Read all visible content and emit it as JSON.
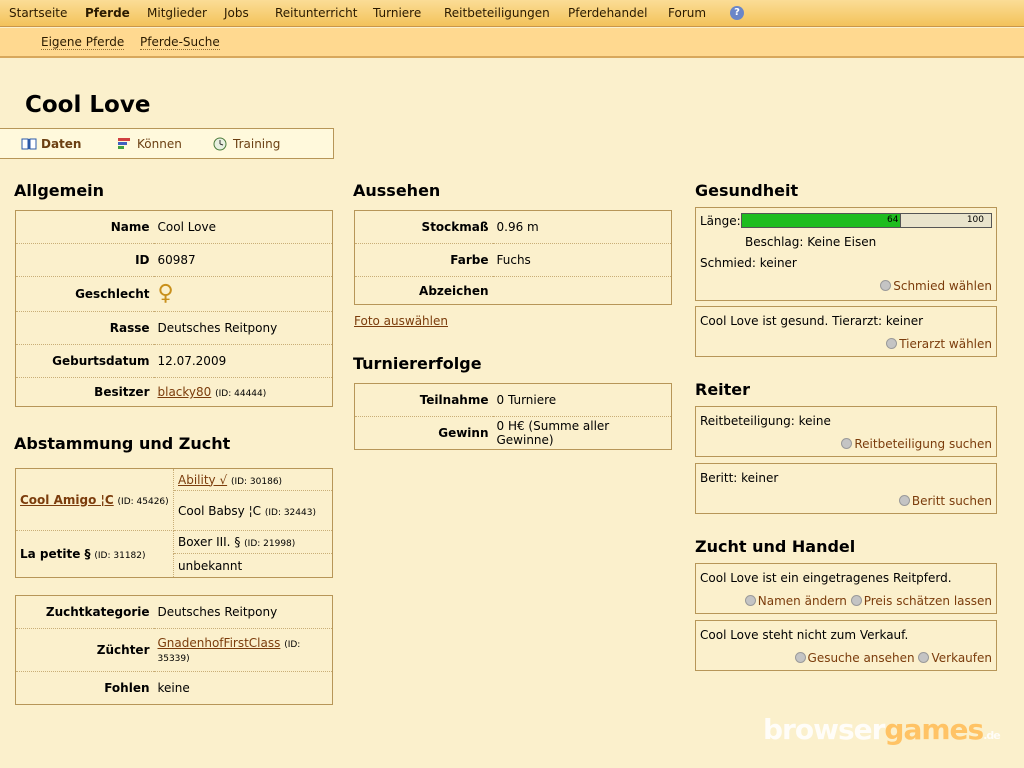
{
  "nav": {
    "items": [
      "Startseite",
      "Pferde",
      "Mitglieder",
      "Jobs",
      "Reitunterricht",
      "Turniere",
      "Reitbeteiligungen",
      "Pferdehandel",
      "Forum"
    ],
    "help": "?"
  },
  "subnav": [
    "Eigene Pferde",
    "Pferde-Suche"
  ],
  "title": "Cool Love",
  "tabs": [
    "Daten",
    "Können",
    "Training"
  ],
  "allgemein": {
    "heading": "Allgemein",
    "name_label": "Name",
    "name": "Cool Love",
    "id_label": "ID",
    "id": "60987",
    "sex_label": "Geschlecht",
    "sex_symbol": "♀",
    "breed_label": "Rasse",
    "breed": "Deutsches Reitpony",
    "birth_label": "Geburtsdatum",
    "birth": "12.07.2009",
    "owner_label": "Besitzer",
    "owner": "blacky80",
    "owner_id": "(ID: 44444)"
  },
  "abstammung": {
    "heading": "Abstammung und Zucht",
    "sire": "Cool Amigo ¦C",
    "sire_id": "(ID: 45426)",
    "sire_sire": "Ability √",
    "sire_sire_id": "(ID: 30186)",
    "sire_dam": "Cool Babsy ¦C",
    "sire_dam_id": "(ID: 32443)",
    "dam": "La petite §",
    "dam_id": "(ID: 31182)",
    "dam_sire": "Boxer III. §",
    "dam_sire_id": "(ID: 21998)",
    "dam_dam": "unbekannt"
  },
  "zucht": {
    "cat_label": "Zuchtkategorie",
    "cat": "Deutsches Reitpony",
    "breeder_label": "Züchter",
    "breeder": "GnadenhofFirstClass",
    "breeder_id": "(ID: 35339)",
    "foals_label": "Fohlen",
    "foals": "keine"
  },
  "aussehen": {
    "heading": "Aussehen",
    "height_label": "Stockmaß",
    "height": "0.96 m",
    "color_label": "Farbe",
    "color": "Fuchs",
    "markings_label": "Abzeichen",
    "markings": "",
    "photo_link": "Foto auswählen"
  },
  "turnier": {
    "heading": "Turniererfolge",
    "part_label": "Teilnahme",
    "part": "0 Turniere",
    "win_label": "Gewinn",
    "win": "0 H€ (Summe aller Gewinne)"
  },
  "gesundheit": {
    "heading": "Gesundheit",
    "length_label": "Länge:",
    "length_value": 64,
    "length_max": 100,
    "length_value_text": "64",
    "length_max_text": "100",
    "shoe": "Beschlag: Keine Eisen",
    "smith": "Schmied: keiner",
    "smith_action": "Schmied wählen",
    "health": "Cool Love ist gesund. Tierarzt: keiner",
    "vet_action": "Tierarzt wählen"
  },
  "reiter": {
    "heading": "Reiter",
    "rb": "Reitbeteiligung: keine",
    "rb_action": "Reitbeteiligung suchen",
    "beritt": "Beritt: keiner",
    "beritt_action": "Beritt suchen"
  },
  "handel": {
    "heading": "Zucht und Handel",
    "reg": "Cool Love ist ein eingetragenes Reitpferd.",
    "rename_action": "Namen ändern",
    "price_action": "Preis schätzen lassen",
    "sale": "Cool Love steht nicht zum Verkauf.",
    "requests_action": "Gesuche ansehen",
    "sell_action": "Verkaufen"
  },
  "watermark": {
    "a": "browser",
    "b": "games",
    "c": ".de"
  },
  "colors": {
    "bg": "#fbf0cc",
    "nav": "#f3c25a",
    "link": "#7b3c0c",
    "bar": "#1fbd1f"
  }
}
